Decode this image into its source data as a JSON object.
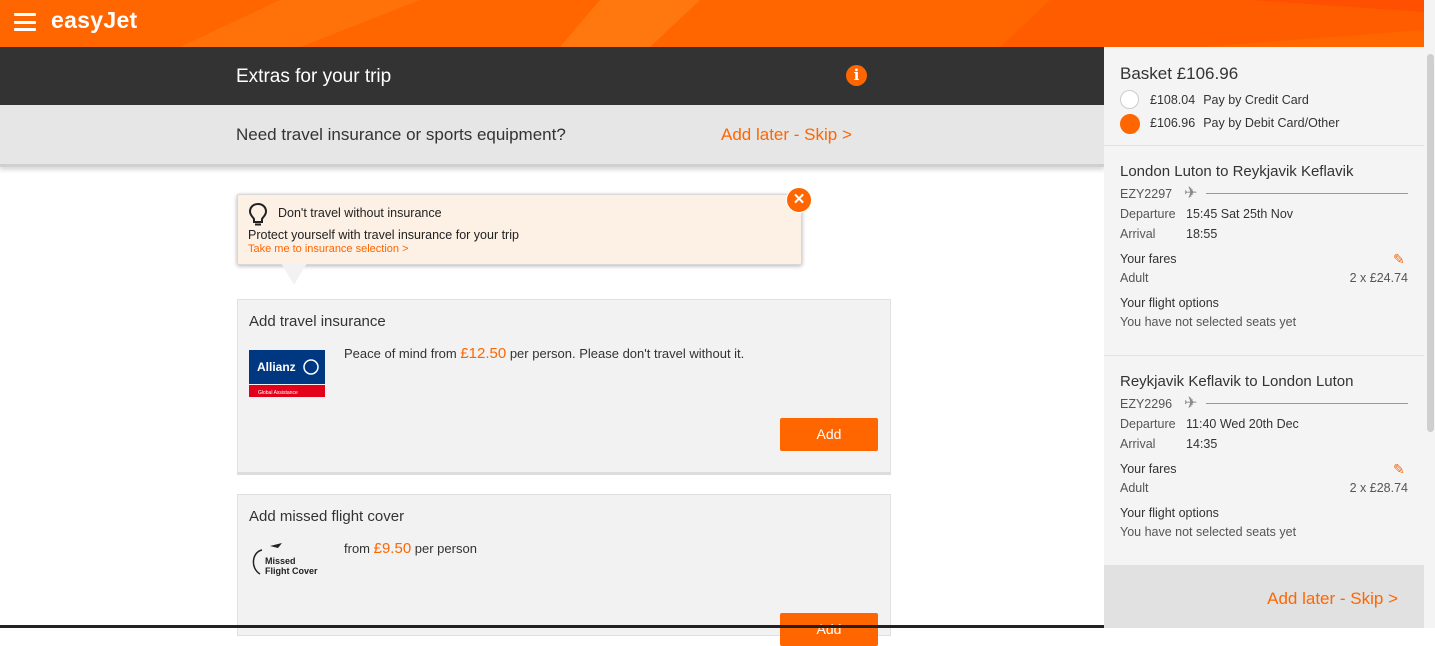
{
  "brand": {
    "logo": "easyJet",
    "accent": "#ff6600",
    "dark": "#333333"
  },
  "header": {
    "title": "Extras for your trip",
    "info_icon": "info-icon"
  },
  "subheader": {
    "question": "Need travel insurance or sports equipment?",
    "skip": "Add later - Skip >"
  },
  "tooltip": {
    "headline": "Don't travel without insurance",
    "body": "Protect yourself with travel insurance for your trip",
    "link": "Take me to insurance selection >"
  },
  "insurance_card": {
    "title": "Add travel insurance",
    "logo_text": "Allianz",
    "logo_sub": "Global Assistance",
    "desc_prefix": "Peace of mind from ",
    "price": "£12.50",
    "desc_suffix": " per person. Please don't travel without it.",
    "button": "Add"
  },
  "missed_card": {
    "title": "Add missed flight cover",
    "logo_line1": "Missed",
    "logo_line2": "Flight Cover",
    "desc_prefix": "from ",
    "price": "£9.50",
    "desc_suffix": " per person",
    "button": "Add"
  },
  "basket": {
    "title": "Basket £106.96",
    "options": [
      {
        "amount": "£108.04",
        "label": "Pay by Credit Card",
        "selected": false
      },
      {
        "amount": "£106.96",
        "label": "Pay by Debit Card/Other",
        "selected": true
      }
    ],
    "flights": [
      {
        "route": "London Luton to Reykjavik Keflavik",
        "flight_no": "EZY2297",
        "departure_label": "Departure",
        "departure": "15:45 Sat 25th Nov",
        "arrival_label": "Arrival",
        "arrival": "18:55",
        "fares_label": "Your fares",
        "passenger": "Adult",
        "fare": "2 x £24.74",
        "options_label": "Your flight options",
        "options_text": "You have not selected seats yet"
      },
      {
        "route": "Reykjavik Keflavik to London Luton",
        "flight_no": "EZY2296",
        "departure_label": "Departure",
        "departure": "11:40 Wed 20th Dec",
        "arrival_label": "Arrival",
        "arrival": "14:35",
        "fares_label": "Your fares",
        "passenger": "Adult",
        "fare": "2 x £28.74",
        "options_label": "Your flight options",
        "options_text": "You have not selected seats yet"
      }
    ],
    "skip": "Add later - Skip >"
  }
}
